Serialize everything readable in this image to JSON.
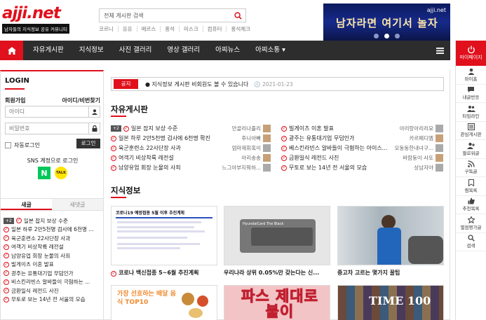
{
  "logo": {
    "name": "ajji.net",
    "tagline": "남자들의 지식정보 공유 커뮤니티"
  },
  "search": {
    "placeholder": "전체 게시판 검색",
    "value": "전체 게시판 검색"
  },
  "quick_links": [
    "코르니",
    "유유",
    "메르스",
    "홍석",
    "미스크",
    "컴퓨터",
    "홍석체크"
  ],
  "banner": {
    "site": "ajji.net",
    "text": "남자라면 여기서 놀자"
  },
  "nav": {
    "items": [
      "자유게시판",
      "지식정보",
      "사진 갤러리",
      "영상 갤러리",
      "아찌뉴스",
      "아찌소통 ▾"
    ]
  },
  "right_sidebar": {
    "my_page": "마이페이지",
    "items": [
      "마이홈",
      "내글반응",
      "타임라인",
      "관심게시판",
      "팔로워글",
      "구독글",
      "찜목록",
      "추천목록",
      "별점평가글",
      "검색"
    ]
  },
  "login": {
    "title": "LOGIN",
    "signup": "회원가입",
    "find": "아이디/비번찾기",
    "id_placeholder": "아이디",
    "pw_placeholder": "비밀번호",
    "auto_login": "자동로그인",
    "login_button": "로그인",
    "sns_label": "SNS 계정으로 로그인",
    "naver": "N",
    "kakao": "TALK"
  },
  "left_tabs": {
    "active": "새글",
    "inactive": "새댓글"
  },
  "left_list": [
    "일본 잡지 보상 수준",
    "일본 하루 2만5천명 검사에 6천명 ...",
    "육군훈련소 22사단장 사과",
    "여객기 비상착륙 레전설",
    "남양유업 회장 눈물의 사죄",
    "빌게이츠 이혼 발표",
    "광주는 유통대기업 무덤인가",
    "비스킨라빈스 알바들이 극혐하는 ...",
    "금환일식 레전드 사진",
    "무토로 보는 14년 전 서울의 모습"
  ],
  "notice": {
    "tag": "공지",
    "text": "● 지식정보 게시판 비회원도 볼 수 있습니다",
    "date": "🕔 2021-01-23"
  },
  "free_board": {
    "title": "자유게시판",
    "left": [
      {
        "title": "일본 잡지 보상 수준",
        "author": "안골리나졸리",
        "badge": "+2"
      },
      {
        "title": "일본 하루 2만5천명 검사에 6천명 확진",
        "author": "후니아빠"
      },
      {
        "title": "육군훈련소 22사단장 사과",
        "author": "엄마제휘혹이"
      },
      {
        "title": "여객기 비상착륙 레전설",
        "author": "아리송송"
      },
      {
        "title": "남양유업 회장 눈물의 사죄",
        "author": "느그아부지뭐하..."
      }
    ],
    "right": [
      {
        "title": "빌게이츠 이혼 발표",
        "author": "아리랑아리리요"
      },
      {
        "title": "광주는 유통대기업 무덤인가",
        "author": "카르페디엠"
      },
      {
        "title": "베스킨라빈스 알바들이 극혐하는 아이스...",
        "author": "모동동한내녀구..."
      },
      {
        "title": "금환일식 레전드 사진",
        "author": "바람둥이 사또"
      },
      {
        "title": "무토로 보는 14년 전 서울의 모습",
        "author": "상남자야"
      }
    ]
  },
  "knowledge": {
    "title": "지식정보",
    "cards": [
      {
        "caption": "코로나 백신접종 5~6월 추진계획",
        "thumb_title": "코로나19 예방접종 5월 이후 추진계획"
      },
      {
        "caption": "우리나라 상위 0.05%만 갖는다는 신...",
        "thumb_title": "HyundaiCard The Black"
      },
      {
        "caption": "중고차 고르는 몇가지 꿀팁",
        "thumb_title": ""
      }
    ],
    "cards_row2": [
      {
        "thumb_title": "가장 선호하는 배달 음식 TOP10"
      },
      {
        "thumb_title": "파스 제대로 붙이"
      },
      {
        "thumb_title": "TIME 100"
      }
    ]
  }
}
